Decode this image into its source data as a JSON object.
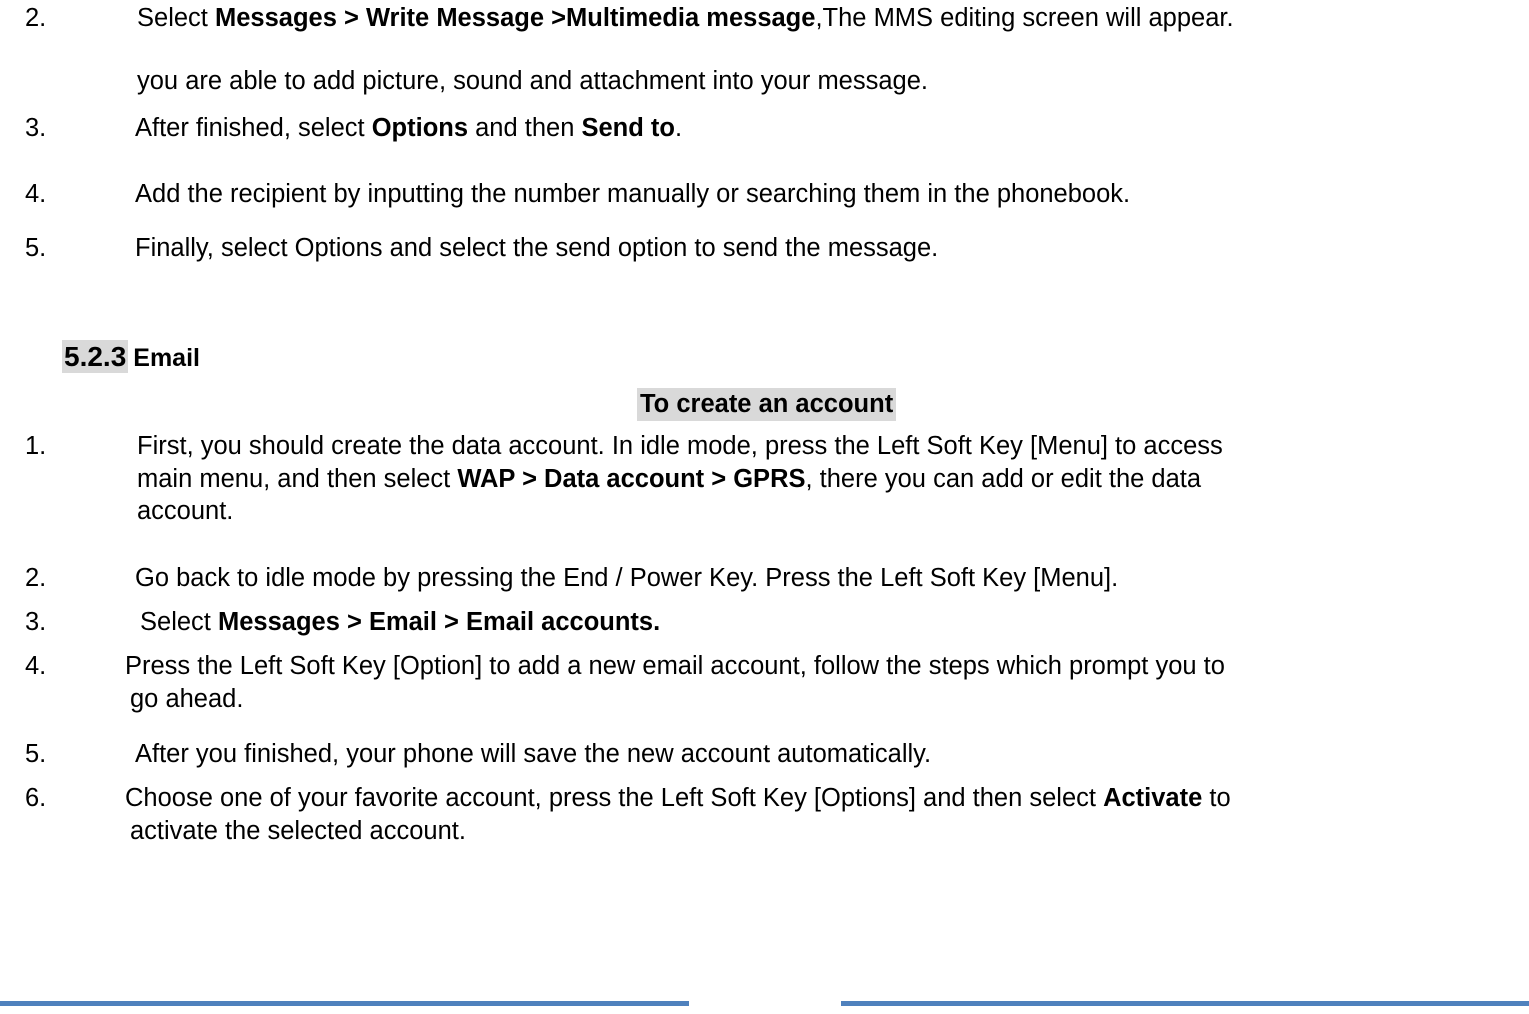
{
  "document": {
    "title": "Mobile phone user manual page — MMS and Email setup",
    "highlight_color": "#d9d9d9",
    "rule_color": "#4f81bd",
    "text_color": "#000000",
    "background_color": "#ffffff"
  },
  "mms_list": {
    "items": [
      {
        "number": "2.",
        "lines": [
          [
            {
              "text": "Select ",
              "bold": false
            },
            {
              "text": "Messages > Write Message >Multimedia message",
              "bold": true
            },
            {
              "text": ",The MMS editing screen will appear.",
              "bold": false
            }
          ],
          [
            {
              "text": " you are able to add picture, sound and attachment into your message.",
              "bold": false
            }
          ]
        ]
      },
      {
        "number": "3.",
        "lines": [
          [
            {
              "text": "After finished, select ",
              "bold": false
            },
            {
              "text": "Options",
              "bold": true
            },
            {
              "text": " and then ",
              "bold": false
            },
            {
              "text": "Send to",
              "bold": true
            },
            {
              "text": ".",
              "bold": false
            }
          ]
        ]
      },
      {
        "number": "4.",
        "lines": [
          [
            {
              "text": "Add the recipient by inputting the number manually or searching them in the phonebook.",
              "bold": false
            }
          ]
        ]
      },
      {
        "number": "5.",
        "lines": [
          [
            {
              "text": "Finally, select Options and select the send option to send the message.",
              "bold": false
            }
          ]
        ]
      }
    ]
  },
  "section": {
    "number": "5.2.3",
    "label": "Email",
    "subheading": "To create an account"
  },
  "email_list": {
    "items": [
      {
        "number": "1.",
        "lines": [
          [
            {
              "text": "First, you should create the data account. In idle mode, press the Left Soft Key [Menu] to access",
              "bold": false
            }
          ],
          [
            {
              "text": "main menu, and then select ",
              "bold": false
            },
            {
              "text": "WAP > Data account > GPRS",
              "bold": true
            },
            {
              "text": ", there you can add or edit the data",
              "bold": false
            }
          ],
          [
            {
              "text": "account.",
              "bold": false
            }
          ]
        ]
      },
      {
        "number": "2.",
        "lines": [
          [
            {
              "text": "Go back to idle mode by pressing the End / Power Key. Press the Left Soft Key [Menu].",
              "bold": false
            }
          ]
        ]
      },
      {
        "number": "3.",
        "lines": [
          [
            {
              "text": "Select ",
              "bold": false
            },
            {
              "text": "Messages > Email > Email accounts.",
              "bold": true
            }
          ]
        ]
      },
      {
        "number": "4.",
        "lines": [
          [
            {
              "text": "Press the Left Soft Key [Option] to add a new email account, follow the steps which prompt you to",
              "bold": false
            }
          ],
          [
            {
              "text": "go ahead.",
              "bold": false
            }
          ]
        ]
      },
      {
        "number": "5.",
        "lines": [
          [
            {
              "text": " After you finished, your phone will save the new account automatically.",
              "bold": false
            }
          ]
        ]
      },
      {
        "number": "6.",
        "lines": [
          [
            {
              "text": "Choose one of your favorite account, press the Left Soft Key [Options] and then select ",
              "bold": false
            },
            {
              "text": "Activate",
              "bold": true
            },
            {
              "text": " to",
              "bold": false
            }
          ],
          [
            {
              "text": "activate the selected account.",
              "bold": false
            }
          ]
        ]
      }
    ]
  }
}
